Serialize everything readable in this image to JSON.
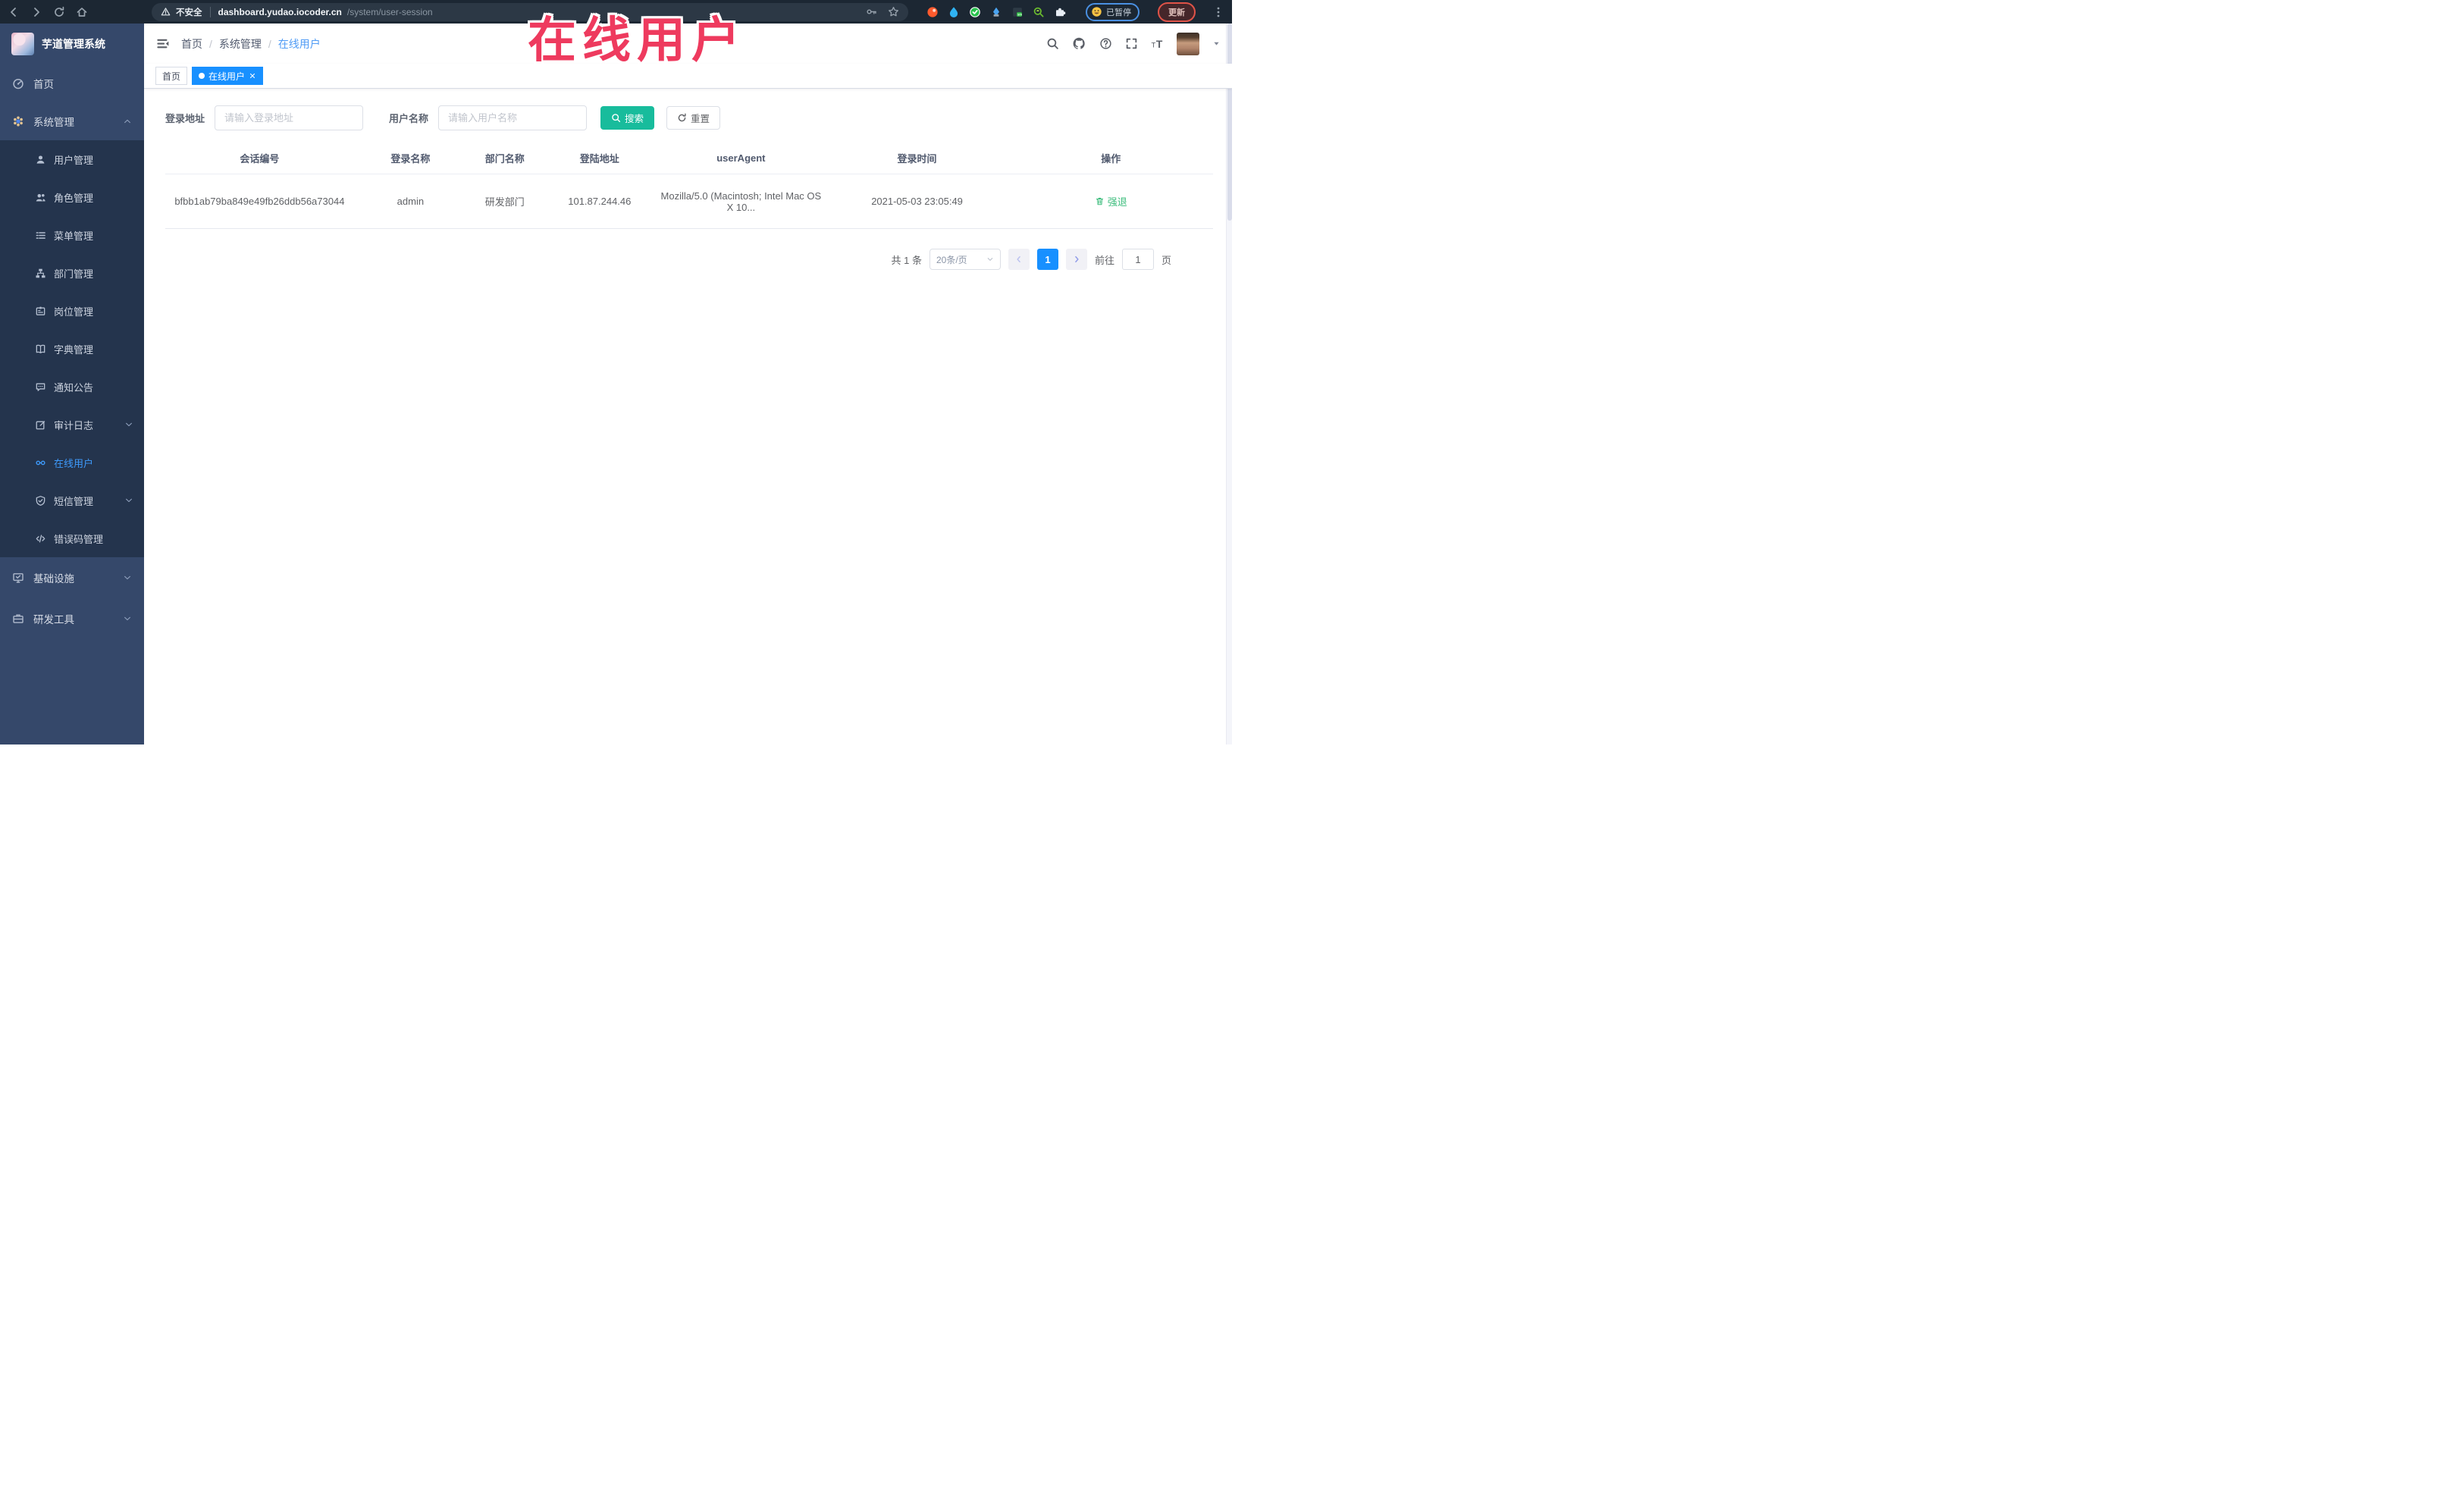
{
  "browser": {
    "security_label": "不安全",
    "url_host": "dashboard.yudao.iocoder.cn",
    "url_path": "/system/user-session",
    "paused_badge": "已暂停",
    "update_button": "更新"
  },
  "overlay": {
    "title": "在线用户"
  },
  "sidebar": {
    "logo_title": "芋道管理系统",
    "items": [
      {
        "label": "首页"
      },
      {
        "label": "系统管理"
      }
    ],
    "submenu": [
      "用户管理",
      "角色管理",
      "菜单管理",
      "部门管理",
      "岗位管理",
      "字典管理",
      "通知公告",
      "审计日志",
      "在线用户",
      "短信管理",
      "错误码管理"
    ],
    "bottom": [
      "基础设施",
      "研发工具"
    ],
    "active_item": "在线用户"
  },
  "header": {
    "breadcrumb": [
      "首页",
      "系统管理",
      "在线用户"
    ]
  },
  "tabs": [
    {
      "label": "首页"
    },
    {
      "label": "在线用户"
    }
  ],
  "filters": {
    "login_address_label": "登录地址",
    "login_address_placeholder": "请输入登录地址",
    "username_label": "用户名称",
    "username_placeholder": "请输入用户名称",
    "search_button": "搜索",
    "reset_button": "重置"
  },
  "table": {
    "headers": [
      "会话编号",
      "登录名称",
      "部门名称",
      "登陆地址",
      "userAgent",
      "登录时间",
      "操作"
    ],
    "rows": [
      {
        "session_id": "bfbb1ab79ba849e49fb26ddb56a73044",
        "username": "admin",
        "department": "研发部门",
        "login_address": "101.87.244.46",
        "user_agent": "Mozilla/5.0 (Macintosh; Intel Mac OS X 10...",
        "login_time": "2021-05-03 23:05:49",
        "action": "强退"
      }
    ]
  },
  "pagination": {
    "total": "共 1 条",
    "page_size": "20条/页",
    "current_page": "1",
    "goto_label": "前往",
    "goto_value": "1",
    "page_unit": "页"
  },
  "colors": {
    "accent_blue": "#1890ff",
    "search_teal": "#18bc9c",
    "action_green": "#3dbd7d",
    "overlay_red": "#ee3a5e",
    "sidebar_bg": "#35486a",
    "submenu_bg": "#24344d"
  }
}
